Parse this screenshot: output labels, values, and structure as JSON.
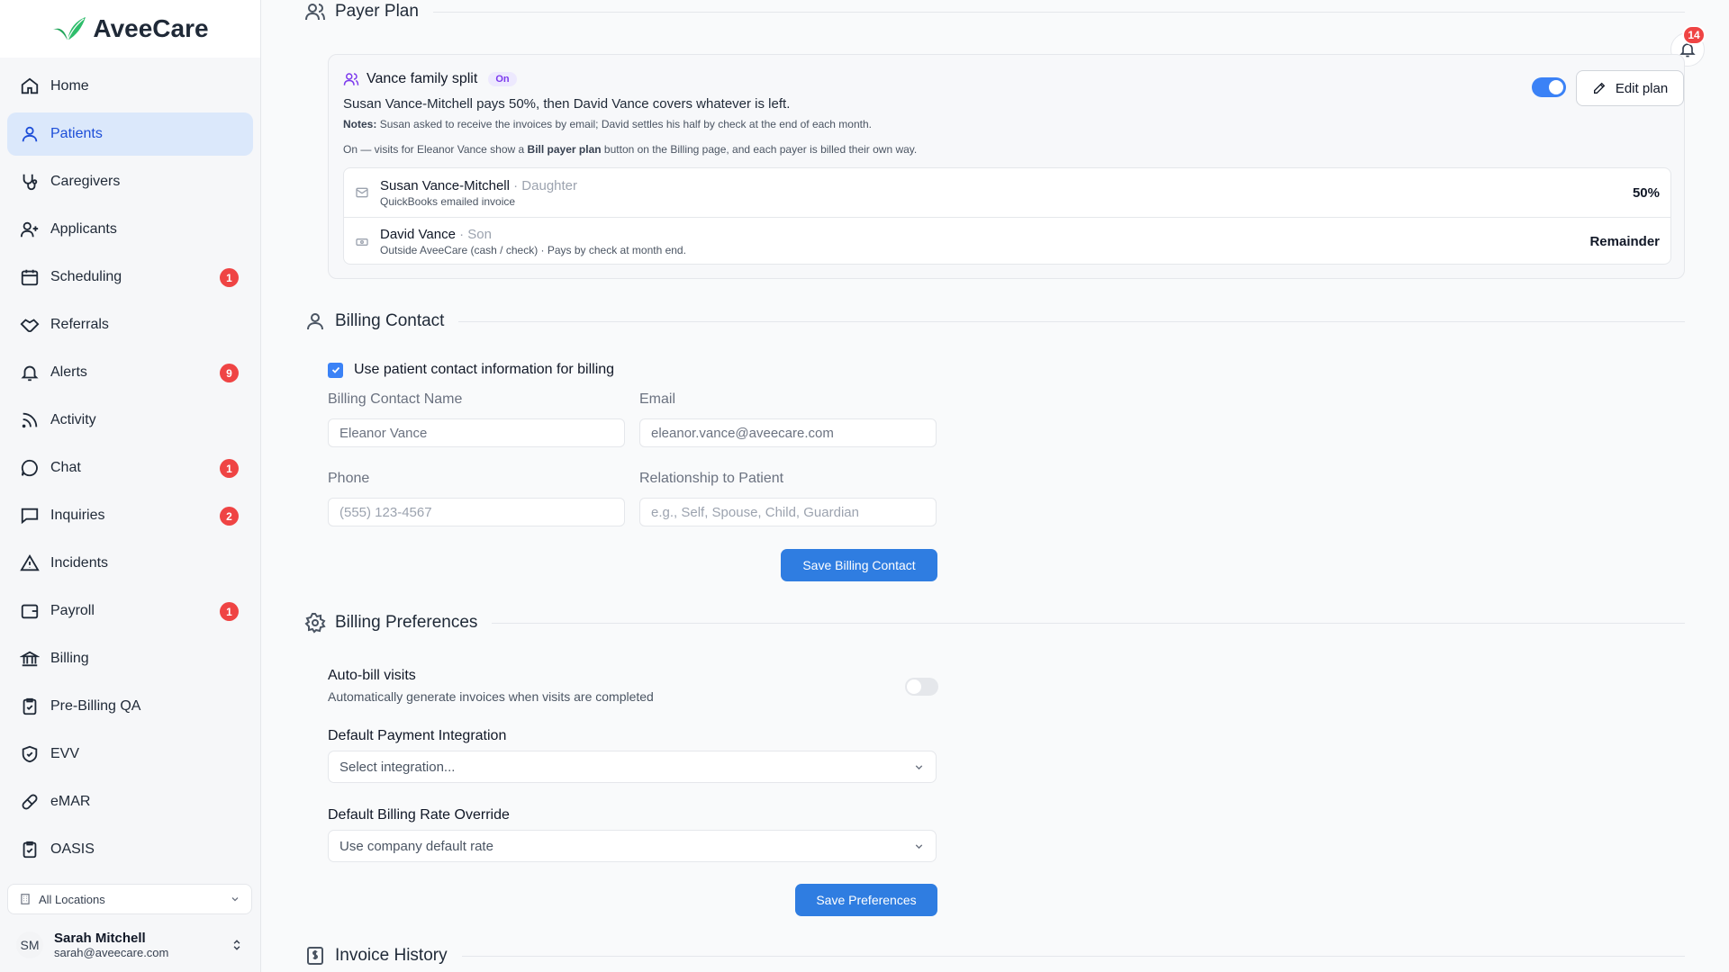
{
  "app": {
    "name": "AveeCare"
  },
  "sidebar": {
    "items": [
      {
        "label": "Home",
        "icon": "home-icon"
      },
      {
        "label": "Patients",
        "icon": "user-icon",
        "active": true
      },
      {
        "label": "Caregivers",
        "icon": "stethoscope-icon"
      },
      {
        "label": "Applicants",
        "icon": "user-plus-icon"
      },
      {
        "label": "Scheduling",
        "icon": "calendar-icon",
        "badge": "1"
      },
      {
        "label": "Referrals",
        "icon": "handshake-icon"
      },
      {
        "label": "Alerts",
        "icon": "bell-icon",
        "badge": "9"
      },
      {
        "label": "Activity",
        "icon": "rss-icon"
      },
      {
        "label": "Chat",
        "icon": "chat-bubble-icon",
        "badge": "1"
      },
      {
        "label": "Inquiries",
        "icon": "message-square-icon",
        "badge": "2"
      },
      {
        "label": "Incidents",
        "icon": "warning-triangle-icon"
      },
      {
        "label": "Payroll",
        "icon": "wallet-icon",
        "badge": "1"
      },
      {
        "label": "Billing",
        "icon": "bank-icon"
      },
      {
        "label": "Pre-Billing QA",
        "icon": "clipboard-check-icon"
      },
      {
        "label": "EVV",
        "icon": "shield-check-icon"
      },
      {
        "label": "eMAR",
        "icon": "pill-icon"
      },
      {
        "label": "OASIS",
        "icon": "clipboard-icon"
      }
    ],
    "location": "All Locations",
    "user": {
      "initials": "SM",
      "name": "Sarah Mitchell",
      "email": "sarah@aveecare.com"
    }
  },
  "notifications": {
    "count": "14"
  },
  "payer_plan": {
    "section_title": "Payer Plan",
    "plan_name": "Vance family split",
    "status": "On",
    "enabled": true,
    "description": "Susan Vance-Mitchell pays 50%, then David Vance covers whatever is left.",
    "notes_label": "Notes:",
    "notes": "Susan asked to receive the invoices by email; David settles his half by check at the end of each month.",
    "on_prefix": "On — visits for Eleanor Vance show a",
    "on_button": "Bill payer plan",
    "on_suffix": "button on the Billing page, and each payer is billed their own way.",
    "edit_label": "Edit plan",
    "payers": [
      {
        "name": "Susan Vance-Mitchell",
        "relation": "· Daughter",
        "method": "QuickBooks emailed invoice",
        "share": "50%",
        "icon": "mail-icon"
      },
      {
        "name": "David Vance",
        "relation": "· Son",
        "method": "Outside AveeCare (cash / check) · Pays by check at month end.",
        "share": "Remainder",
        "icon": "cash-icon"
      }
    ]
  },
  "billing_contact": {
    "section_title": "Billing Contact",
    "use_patient_label": "Use patient contact information for billing",
    "use_patient_checked": true,
    "name_label": "Billing Contact Name",
    "name_value": "Eleanor Vance",
    "email_label": "Email",
    "email_value": "eleanor.vance@aveecare.com",
    "phone_label": "Phone",
    "phone_placeholder": "(555) 123-4567",
    "relationship_label": "Relationship to Patient",
    "relationship_placeholder": "e.g., Self, Spouse, Child, Guardian",
    "save_label": "Save Billing Contact"
  },
  "billing_preferences": {
    "section_title": "Billing Preferences",
    "autobill_label": "Auto-bill visits",
    "autobill_desc": "Automatically generate invoices when visits are completed",
    "autobill_enabled": false,
    "integration_label": "Default Payment Integration",
    "integration_value": "Select integration...",
    "rate_label": "Default Billing Rate Override",
    "rate_value": "Use company default rate",
    "save_label": "Save Preferences"
  },
  "invoice_history": {
    "section_title": "Invoice History"
  },
  "colors": {
    "primary": "#2f7de1",
    "badge": "#ef4444",
    "active_nav": "#dbe8fb",
    "status_on": "#7c3aed"
  }
}
